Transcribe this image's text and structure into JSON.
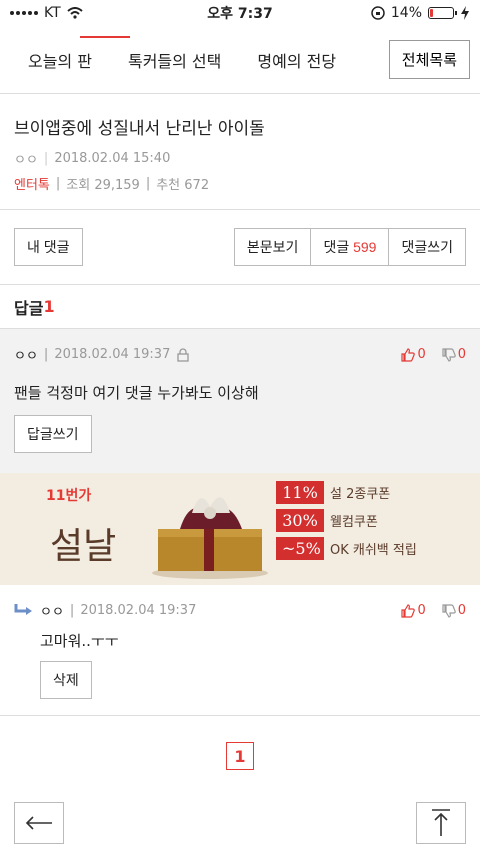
{
  "status": {
    "carrier": "KT",
    "time": "오후 7:37",
    "battery": "14%",
    "battery_fill": 0.14,
    "battery_color": "#e53935"
  },
  "nav": {
    "tabs": [
      "오늘의 판",
      "톡커들의 선택",
      "명예의 전당"
    ],
    "all_button": "전체목록"
  },
  "article": {
    "title": "브이앱중에 성질내서 난리난 아이돌",
    "author": "ㅇㅇ",
    "datetime": "2018.02.04 15:40",
    "category": "엔터톡",
    "views": "조회 29,159",
    "recommend": "추천 672"
  },
  "actions": {
    "my_comments": "내 댓글",
    "view_body": "본문보기",
    "comments_label": "댓글",
    "comments_count": "599",
    "write_comment": "댓글쓰기"
  },
  "replies": {
    "label": "답글",
    "count": "1"
  },
  "comment": {
    "author": "ㅇㅇ",
    "datetime": "2018.02.04 19:37",
    "up": "0",
    "down": "0",
    "body": "팬들 걱정마 여기 댓글 누가봐도 이상해",
    "reply_button": "답글쓰기"
  },
  "ad": {
    "brand": "11번가",
    "headline": "설날",
    "coupons": [
      {
        "badge": "11%",
        "text": "설 2종쿠폰"
      },
      {
        "badge": "30%",
        "text": "웰컴쿠폰"
      },
      {
        "badge": "~5%",
        "text": "OK 캐쉬백 적립"
      }
    ]
  },
  "reply": {
    "author": "ㅇㅇ",
    "datetime": "2018.02.04 19:37",
    "up": "0",
    "down": "0",
    "body": "고마워..ㅜㅜ",
    "delete_button": "삭제"
  },
  "pager": {
    "current": "1"
  },
  "colors": {
    "accent": "#e53935"
  }
}
